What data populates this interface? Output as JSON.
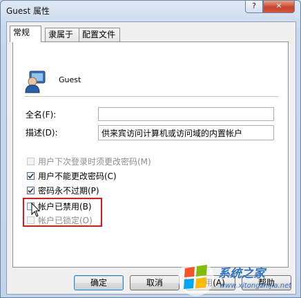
{
  "window": {
    "title": "Guest 属性",
    "help_glyph": "?",
    "close_glyph": "✕"
  },
  "tabs": [
    {
      "label": "常规",
      "active": true
    },
    {
      "label": "隶属于",
      "active": false
    },
    {
      "label": "配置文件",
      "active": false
    }
  ],
  "general": {
    "user_name": "Guest",
    "full_name_label": "全名(F):",
    "full_name_value": "",
    "description_label": "描述(D):",
    "description_value": "供来宾访问计算机或访问域的内置帐户"
  },
  "options": [
    {
      "label": "用户下次登录时须更改密码(M)",
      "checked": false,
      "enabled": false
    },
    {
      "label": "用户不能更改密码(C)",
      "checked": true,
      "enabled": true
    },
    {
      "label": "密码永不过期(P)",
      "checked": true,
      "enabled": true
    },
    {
      "label": "帐户已禁用(B)",
      "checked": false,
      "enabled": true
    },
    {
      "label": "帐户已锁定(O)",
      "checked": false,
      "enabled": false
    }
  ],
  "buttons": {
    "ok": "确定",
    "cancel": "取消",
    "apply": "应用(A)",
    "help": "帮助"
  },
  "watermark": {
    "text": "系统之家",
    "url": "www.xitongzhijia.net"
  },
  "colors": {
    "highlight_box": "#e5151d",
    "close_button": "#c9432b"
  }
}
